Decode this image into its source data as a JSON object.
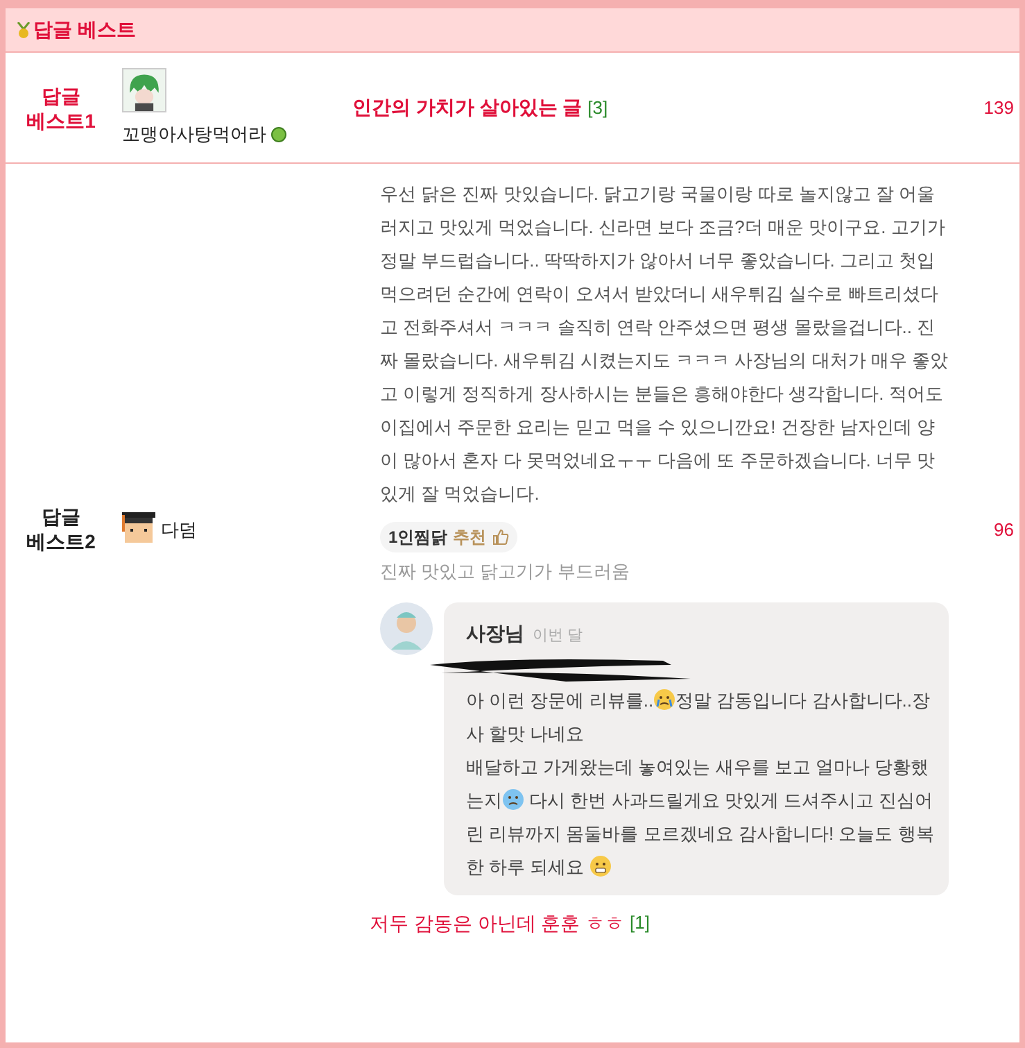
{
  "header": {
    "title": "답글 베스트"
  },
  "rows": [
    {
      "kind": "link",
      "rank": "답글\n베스트1",
      "color": "#e0103a",
      "user": {
        "avatar": {
          "kind": "green-hair"
        },
        "name": "꼬맹아사탕먹어라",
        "online": true
      },
      "title": "인간의 가치가 살아있는 글",
      "comment_count": "[3]",
      "views": "139"
    },
    {
      "kind": "screenshot",
      "rank": "답글\n베스트2",
      "color": "#222222",
      "user": {
        "avatar": {
          "kind": "pixel"
        },
        "name": "다덤",
        "online": false
      },
      "review": {
        "body": "우선 닭은 진짜 맛있습니다. 닭고기랑 국물이랑 따로 놀지않고 잘 어울러지고 맛있게 먹었습니다. 신라면 보다 조금?더 매운 맛이구요. 고기가 정말 부드럽습니다.. 딱딱하지가 않아서 너무 좋았습니다. 그리고 첫입 먹으려던 순간에 연락이 오셔서 받았더니 새우튀김 실수로 빠트리셨다고 전화주셔서 ㅋㅋㅋ 솔직히 연락 안주셨으면 평생 몰랐을겁니다.. 진짜 몰랐습니다. 새우튀김 시켰는지도 ㅋㅋㅋ 사장님의 대처가 매우 좋았고 이렇게 정직하게 장사하시는 분들은 흥해야한다 생각합니다. 적어도 이집에서 주문한 요리는 믿고 먹을 수 있으니깐요! 건장한 남자인데 양이 많아서 혼자 다 못먹었네요ㅜㅜ 다음에 또 주문하겠습니다. 너무 맛있게 잘 먹었습니다.",
        "menu": "1인찜닭",
        "recommend": "추천",
        "menu_note": "진짜 맛있고 닭고기가 부드러움",
        "reply": {
          "author": "사장님",
          "time": "이번 달",
          "paragraphs": [
            [
              {
                "kind": "text",
                "text": "아 이런 장문에 리뷰를.."
              },
              {
                "kind": "crying"
              },
              {
                "kind": "text",
                "text": "정말 감동입니다 감사합니다..장사 할맛 나네요"
              }
            ],
            [
              {
                "kind": "text",
                "text": "배달하고 가게왔는데 놓여있는 새우를 보고 얼마나 당황했는지"
              },
              {
                "kind": "cold"
              },
              {
                "kind": "text",
                "text": " 다시 한번 사과드릴게요 맛있게 드셔주시고 진심어린 리뷰까지 몸둘바를 모르겠네요 감사합니다! 오늘도 행복한 하루 되세요 "
              },
              {
                "kind": "grin"
              }
            ]
          ]
        }
      },
      "caption": "저두 감동은 아닌데 훈훈 ㅎㅎ",
      "comment_count": "[1]",
      "views": "96"
    }
  ]
}
